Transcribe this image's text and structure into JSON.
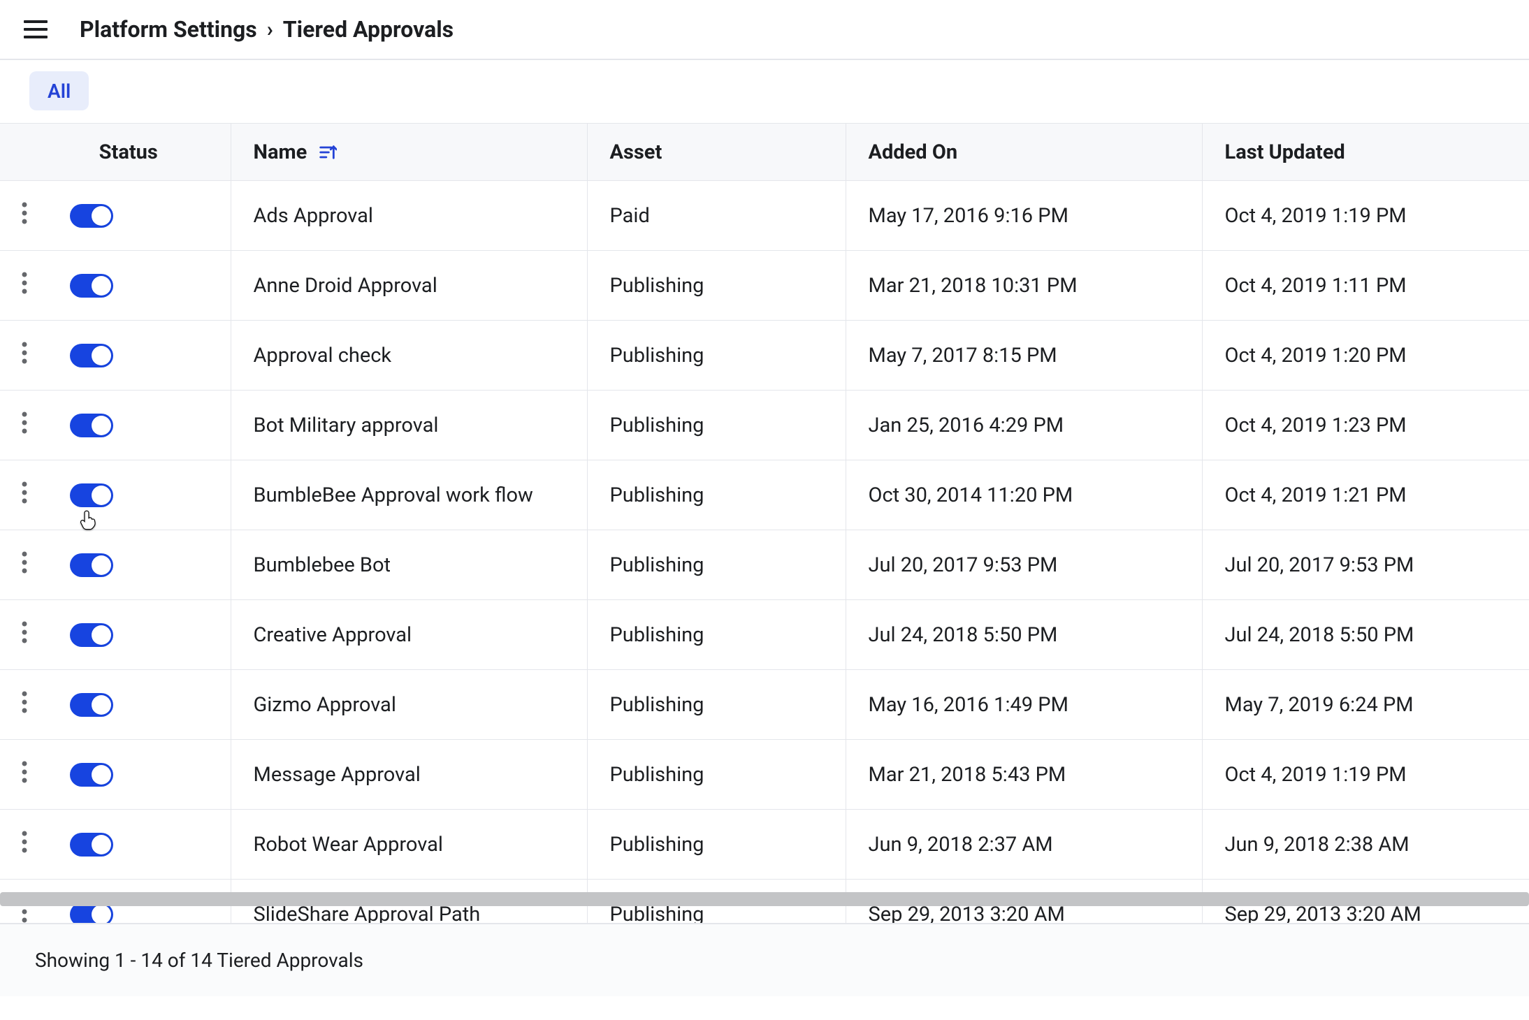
{
  "header": {
    "breadcrumb_parent": "Platform Settings",
    "breadcrumb_current": "Tiered Approvals"
  },
  "filters": {
    "all_label": "All"
  },
  "table": {
    "columns": {
      "status": "Status",
      "name": "Name",
      "asset": "Asset",
      "added_on": "Added On",
      "last_updated": "Last Updated"
    },
    "rows": [
      {
        "status_on": true,
        "name": "Ads Approval",
        "asset": "Paid",
        "added_on": "May 17, 2016 9:16 PM",
        "last_updated": "Oct 4, 2019 1:19 PM"
      },
      {
        "status_on": true,
        "name": "Anne Droid Approval",
        "asset": "Publishing",
        "added_on": "Mar 21, 2018 10:31 PM",
        "last_updated": "Oct 4, 2019 1:11 PM"
      },
      {
        "status_on": true,
        "name": "Approval check",
        "asset": "Publishing",
        "added_on": "May 7, 2017 8:15 PM",
        "last_updated": "Oct 4, 2019 1:20 PM"
      },
      {
        "status_on": true,
        "name": "Bot Military approval",
        "asset": "Publishing",
        "added_on": "Jan 25, 2016 4:29 PM",
        "last_updated": "Oct 4, 2019 1:23 PM"
      },
      {
        "status_on": true,
        "name": "BumbleBee Approval work flow",
        "asset": "Publishing",
        "added_on": "Oct 30, 2014 11:20 PM",
        "last_updated": "Oct 4, 2019 1:21 PM"
      },
      {
        "status_on": true,
        "name": "Bumblebee Bot",
        "asset": "Publishing",
        "added_on": "Jul 20, 2017 9:53 PM",
        "last_updated": "Jul 20, 2017 9:53 PM"
      },
      {
        "status_on": true,
        "name": "Creative Approval",
        "asset": "Publishing",
        "added_on": "Jul 24, 2018 5:50 PM",
        "last_updated": "Jul 24, 2018 5:50 PM"
      },
      {
        "status_on": true,
        "name": "Gizmo Approval",
        "asset": "Publishing",
        "added_on": "May 16, 2016 1:49 PM",
        "last_updated": "May 7, 2019 6:24 PM"
      },
      {
        "status_on": true,
        "name": "Message Approval",
        "asset": "Publishing",
        "added_on": "Mar 21, 2018 5:43 PM",
        "last_updated": "Oct 4, 2019 1:19 PM"
      },
      {
        "status_on": true,
        "name": "Robot Wear Approval",
        "asset": "Publishing",
        "added_on": "Jun 9, 2018 2:37 AM",
        "last_updated": "Jun 9, 2018 2:38 AM"
      },
      {
        "status_on": true,
        "name": "SlideShare Approval Path",
        "asset": "Publishing",
        "added_on": "Sep 29, 2013 3:20 AM",
        "last_updated": "Sep 29, 2013 3:20 AM"
      }
    ]
  },
  "footer": {
    "showing_text": "Showing 1 - 14 of 14 Tiered Approvals"
  }
}
